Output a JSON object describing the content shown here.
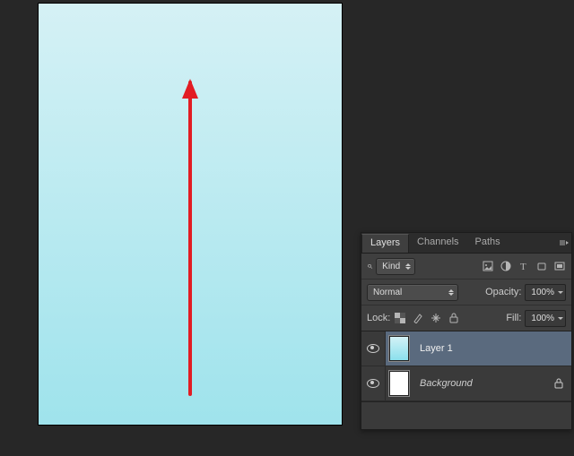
{
  "canvas": {
    "arrow_color": "#e21c23",
    "gradient_top": "#d5f1f5",
    "gradient_bottom": "#9fe3ec"
  },
  "panel": {
    "tabs": {
      "layers": "Layers",
      "channels": "Channels",
      "paths": "Paths"
    },
    "filter_label": "Kind",
    "blend_mode": "Normal",
    "opacity_label": "Opacity:",
    "opacity_value": "100%",
    "lock_label": "Lock:",
    "fill_label": "Fill:",
    "fill_value": "100%",
    "layers": [
      {
        "name": "Layer 1",
        "locked": false
      },
      {
        "name": "Background",
        "locked": true
      }
    ]
  }
}
